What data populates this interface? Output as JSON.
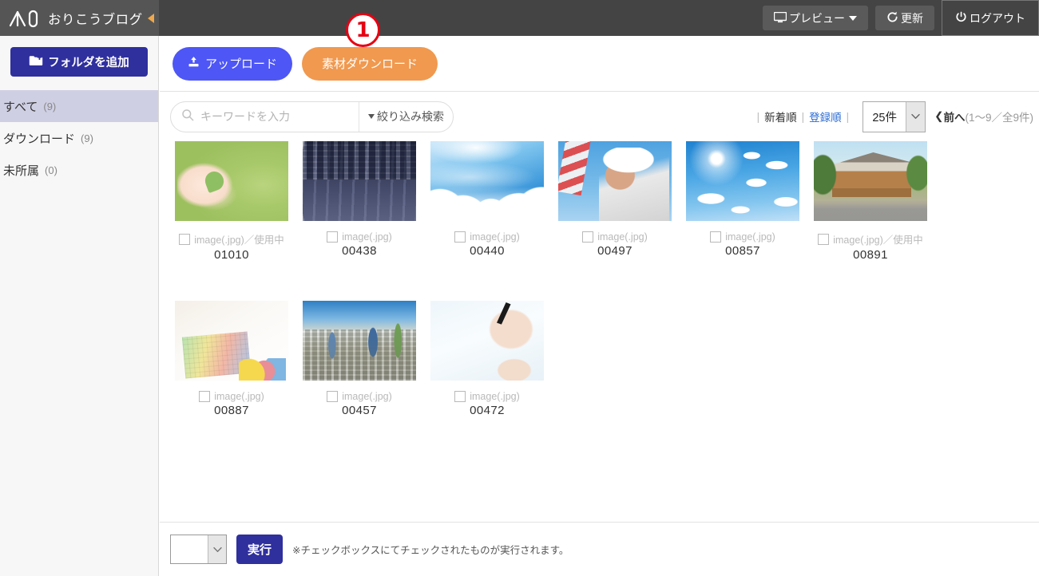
{
  "header": {
    "brand": "おりこうブログ",
    "logo_icon": "oricoblog-logo-icon",
    "collapse_icon": "collapse-left-arrow-icon",
    "preview_label": "プレビュー",
    "preview_icon": "monitor-icon",
    "refresh_label": "更新",
    "refresh_icon": "refresh-icon",
    "logout_label": "ログアウト",
    "logout_icon": "power-icon"
  },
  "sidebar": {
    "add_folder_label": "フォルダを追加",
    "add_folder_icon": "folder-plus-icon",
    "items": [
      {
        "label": "すべて",
        "count": "(9)",
        "active": true
      },
      {
        "label": "ダウンロード",
        "count": "(9)",
        "active": false
      },
      {
        "label": "未所属",
        "count": "(0)",
        "active": false
      }
    ]
  },
  "actions": {
    "upload_label": "アップロード",
    "upload_icon": "upload-icon",
    "download_label": "素材ダウンロード",
    "annotation_1": "1"
  },
  "search": {
    "placeholder": "キーワードを入力",
    "value": "",
    "icon": "search-icon",
    "filter_label": "絞り込み検索",
    "filter_caret_icon": "caret-down-icon"
  },
  "sort": {
    "sep_left": "|",
    "newest_label": "新着順",
    "sep_mid": "|",
    "registered_label": "登録順",
    "sep_right": "|",
    "per_page_value": "25件",
    "per_page_caret_icon": "chevron-down-icon",
    "pager_prev_icon": "chevron-left-icon",
    "pager_prev_label": "前へ",
    "pager_range": "(1〜9／全9件)"
  },
  "grid": {
    "items": [
      {
        "label": "image(.jpg)／使用中",
        "number": "01010",
        "art": "a-hands",
        "alt": "hands-holding-leaf-thumbnail"
      },
      {
        "label": "image(.jpg)",
        "number": "00438",
        "art": "a-city-night",
        "alt": "night-highway-city-thumbnail"
      },
      {
        "label": "image(.jpg)",
        "number": "00440",
        "art": "a-sky-rays",
        "alt": "blue-sky-light-rays-thumbnail"
      },
      {
        "label": "image(.jpg)",
        "number": "00497",
        "art": "a-worker",
        "alt": "construction-worker-thumbnail"
      },
      {
        "label": "image(.jpg)",
        "number": "00857",
        "art": "a-sunny",
        "alt": "sunny-sky-clouds-thumbnail"
      },
      {
        "label": "image(.jpg)／使用中",
        "number": "00891",
        "art": "a-house",
        "alt": "modern-wooden-house-thumbnail"
      },
      {
        "label": "image(.jpg)",
        "number": "00887",
        "art": "a-swatch",
        "alt": "color-swatch-desk-thumbnail"
      },
      {
        "label": "image(.jpg)",
        "number": "00457",
        "art": "a-city-day",
        "alt": "aerial-city-view-thumbnail"
      },
      {
        "label": "image(.jpg)",
        "number": "00472",
        "art": "a-write",
        "alt": "hand-writing-pen-thumbnail"
      }
    ]
  },
  "footer": {
    "select_value": "",
    "select_caret_icon": "chevron-down-icon",
    "exec_label": "実行",
    "note": "※チェックボックスにてチェックされたものが実行されます。"
  },
  "colors": {
    "header_bg": "#444444",
    "logo_bg": "#555555",
    "primary": "#2f2f9e",
    "upload": "#4e56f5",
    "download": "#f0994f",
    "active_folder": "#cfcfe4",
    "link": "#2b6cd4",
    "annotation": "#e60012"
  }
}
